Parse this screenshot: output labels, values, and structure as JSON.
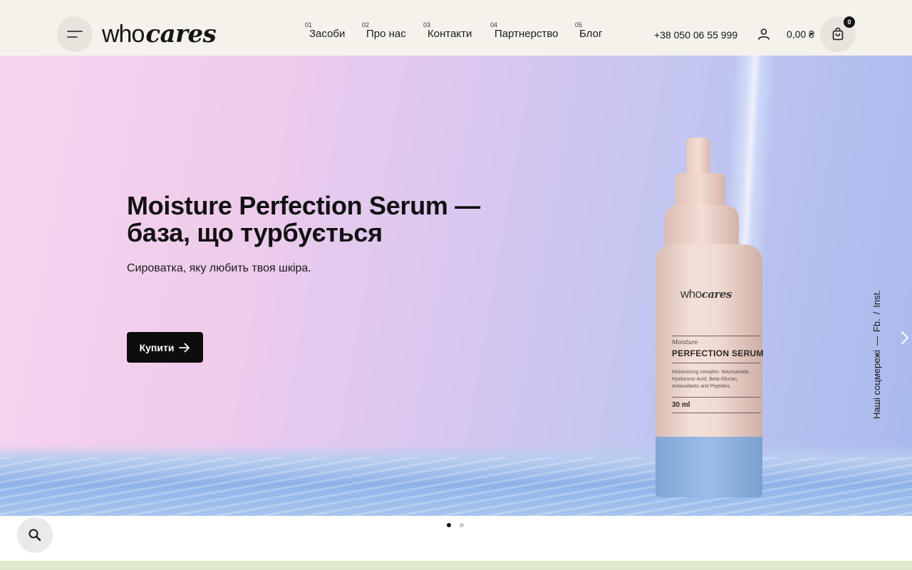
{
  "brand": {
    "logo_who": "who",
    "logo_cares": "cares"
  },
  "header": {
    "nav": [
      {
        "num": "01",
        "label": "Засоби"
      },
      {
        "num": "02",
        "label": "Про нас"
      },
      {
        "num": "03",
        "label": "Контакти"
      },
      {
        "num": "04",
        "label": "Партнерство"
      },
      {
        "num": "05",
        "label": "Блог"
      }
    ],
    "phone": "+38 050 06 55 999",
    "cart_total": "0,00 ₴",
    "cart_count": "0"
  },
  "hero": {
    "title": "Moisture Perfection Serum — база, що турбується",
    "subtitle": "Сироватка, яку любить твоя шкіра.",
    "cta_label": "Купити",
    "active_slide": 1,
    "slide_count": 2
  },
  "product": {
    "brand_who": "who",
    "brand_cares": "cares",
    "line": "Moisture",
    "name": "PERFECTION SERUM",
    "description": "Moisturizing complex: Niacinamide, Hyaluronic Acid, Beta-Glucan, Antioxidants and Peptides.",
    "volume": "30 ml"
  },
  "social": {
    "label": "Наші соцмережі",
    "dash": "—",
    "fb": "Fb.",
    "sep": "/",
    "inst": "Inst."
  },
  "colors": {
    "header_bg": "#f5f2ec",
    "accent_dark": "#0d0d0d",
    "icon_button_bg": "#e8e4dd",
    "bottom_strip": "#dfe7cc"
  },
  "icons": {
    "menu": "menu-icon",
    "user": "user-icon",
    "cart": "shopping-bag-icon",
    "arrow": "arrow-right-icon",
    "next": "chevron-right-icon",
    "search": "search-icon"
  }
}
